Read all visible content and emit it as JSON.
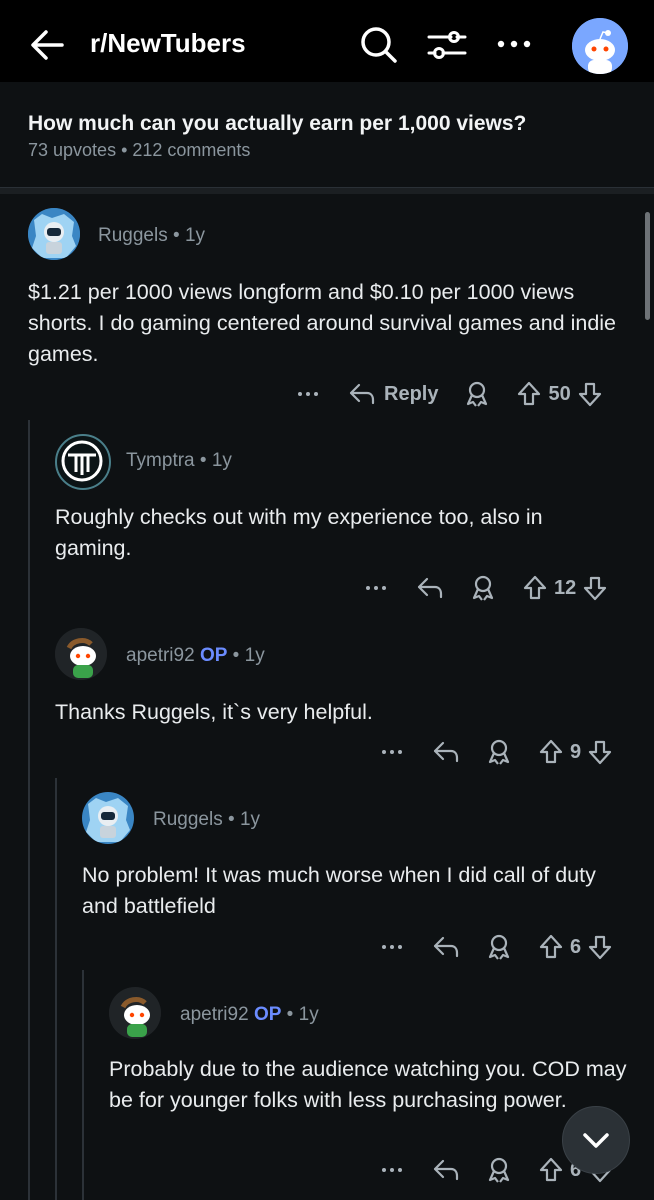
{
  "header": {
    "subreddit": "r/NewTubers",
    "icons": [
      "back-arrow-icon",
      "search-icon",
      "filter-icon",
      "more-icon",
      "user-avatar"
    ]
  },
  "post": {
    "title": "How much can you actually earn per 1,000 views?",
    "meta": "73 upvotes • 212 comments"
  },
  "comments": [
    {
      "user": "Ruggels",
      "time": "1y",
      "op": "",
      "body": "$1.21 per 1000 views longform and $0.10 per 1000 views shorts. I do gaming centered around survival games and indie games.",
      "reply_label": "Reply",
      "score": "50"
    },
    {
      "user": "Tymptra",
      "time": "1y",
      "op": "",
      "body": "Roughly checks out with my experience too, also in gaming.",
      "reply_label": "",
      "score": "12"
    },
    {
      "user": "apetri92",
      "time": "1y",
      "op": "OP",
      "body": "Thanks Ruggels, it`s very helpful.",
      "reply_label": "",
      "score": "9"
    },
    {
      "user": "Ruggels",
      "time": "1y",
      "op": "",
      "body": "No problem! It was much worse when I did call of duty and battlefield",
      "reply_label": "",
      "score": "6"
    },
    {
      "user": "apetri92",
      "time": "1y",
      "op": "OP",
      "body": "Probably due to the audience watching you. COD may be for younger folks with less purchasing power.",
      "reply_label": "",
      "score": "6"
    }
  ],
  "colors": {
    "background": "#0e1113",
    "op": "#6b8cff",
    "meta": "#8b969e"
  }
}
